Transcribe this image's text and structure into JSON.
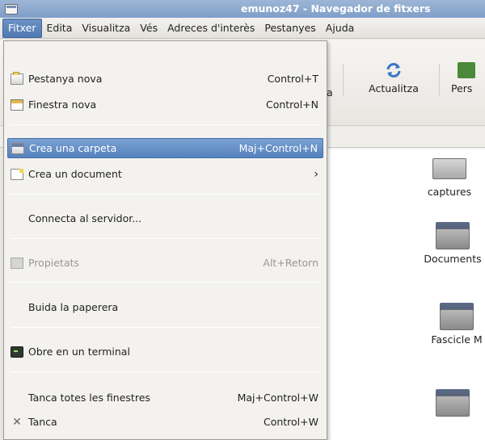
{
  "window": {
    "title": "emunoz47 - Navegador de fitxers"
  },
  "menubar": [
    {
      "label": "Fitxer",
      "open": true
    },
    {
      "label": "Edita"
    },
    {
      "label": "Visualitza"
    },
    {
      "label": "Vés"
    },
    {
      "label": "Adreces d'interès"
    },
    {
      "label": "Pestanyes"
    },
    {
      "label": "Ajuda"
    }
  ],
  "toolbar": {
    "partial_label": "a",
    "reload_label": "Actualitza",
    "next_label": "Pers"
  },
  "file_menu": {
    "new_tab": {
      "label": "Pestanya nova",
      "accel": "Control+T"
    },
    "new_window": {
      "label": "Finestra nova",
      "accel": "Control+N"
    },
    "create_folder": {
      "label": "Crea una carpeta",
      "accel": "Maj+Control+N"
    },
    "create_document": {
      "label": "Crea un document",
      "submenu": "›"
    },
    "connect_server": {
      "label": "Connecta al servidor..."
    },
    "properties": {
      "label": "Propietats",
      "accel": "Alt+Retorn"
    },
    "empty_trash": {
      "label": "Buida la paperera"
    },
    "open_terminal": {
      "label": "Obre en un terminal"
    },
    "close_all": {
      "label": "Tanca totes les finestres",
      "accel": "Maj+Control+W"
    },
    "close": {
      "label": "Tanca",
      "accel": "Control+W"
    }
  },
  "files": [
    {
      "name": "captures"
    },
    {
      "name": "Documents"
    },
    {
      "name": "Fascicle M"
    }
  ],
  "colors": {
    "highlight": "#5582bd",
    "titlebar": "#7f9ec7"
  }
}
